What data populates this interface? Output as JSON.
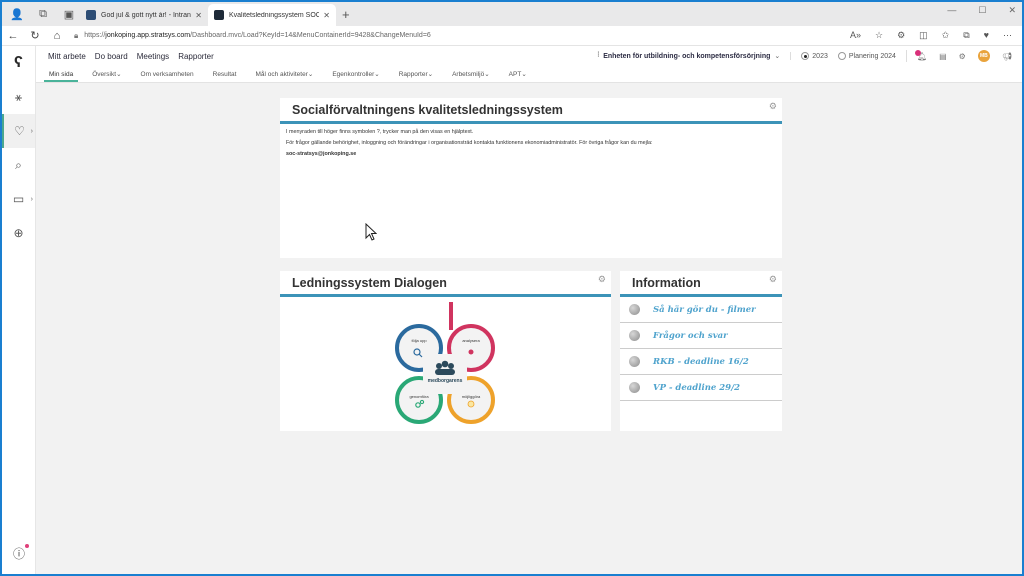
{
  "browser": {
    "tabs": [
      {
        "title": "God jul & gott nytt år! - Intranät",
        "active": false,
        "favicon_color": "#2d4d75"
      },
      {
        "title": "Kvalitetsledningssystem SOC - Str",
        "active": true,
        "favicon_color": "#1e2a38"
      }
    ],
    "url_prefix": "https://",
    "url_host": "jonkoping.app.stratsys.com",
    "url_path": "/Dashboard.mvc/Load?KeyId=14&MenuContainerId=9428&ChangeMenuId=6",
    "window_controls": [
      "minimize",
      "maximize",
      "close"
    ]
  },
  "app": {
    "topnav": [
      "Mitt arbete",
      "Do board",
      "Meetings",
      "Rapporter"
    ],
    "unit_label": "Enheten för utbildning- och kompetensförsörjning",
    "year_options": [
      {
        "label": "2023",
        "selected": true
      },
      {
        "label": "Planering 2024",
        "selected": false
      }
    ],
    "avatar_initials": "MB",
    "subnav": [
      {
        "label": "Min sida",
        "active": true,
        "dropdown": false
      },
      {
        "label": "Översikt",
        "active": false,
        "dropdown": true
      },
      {
        "label": "Om verksamheten",
        "active": false,
        "dropdown": false
      },
      {
        "label": "Resultat",
        "active": false,
        "dropdown": false
      },
      {
        "label": "Mål och aktiviteter",
        "active": false,
        "dropdown": true
      },
      {
        "label": "Egenkontroller",
        "active": false,
        "dropdown": true
      },
      {
        "label": "Rapporter",
        "active": false,
        "dropdown": true
      },
      {
        "label": "Arbetsmiljö",
        "active": false,
        "dropdown": true
      },
      {
        "label": "APT",
        "active": false,
        "dropdown": true
      }
    ]
  },
  "widgets": {
    "main": {
      "title": "Socialförvaltningens kvalitetsledningssystem",
      "lines": [
        "I menyraden till höger finns symbolen ?, trycker man på den visas en hjälptext.",
        "För frågor gällande behörighet,  inloggning och förändringar i organisationsträd kontakta funktionens ekonomiadministratör. För övriga frågor kan du mejla:"
      ],
      "email": "soc-stratsys@jonkoping.se"
    },
    "dialog": {
      "title": "Ledningssystem Dialogen",
      "diagram": {
        "center_label": "medborgarens",
        "nodes": [
          {
            "label": "följa upp",
            "color": "#2b6a9e"
          },
          {
            "label": "analysera",
            "color": "#d0345f"
          },
          {
            "label": "genomföra",
            "color": "#2aa876"
          },
          {
            "label": "möjliggöra",
            "color": "#eea22b"
          }
        ]
      }
    },
    "info": {
      "title": "Information",
      "links": [
        "Så här gör du - filmer",
        "Frågor och svar",
        "RKB - deadline 16/2",
        "VP - deadline 29/2"
      ]
    }
  },
  "colors": {
    "accent_bar": "#3c93b8",
    "link": "#4fa3cd",
    "active_tab_underline": "#4ab39a"
  }
}
